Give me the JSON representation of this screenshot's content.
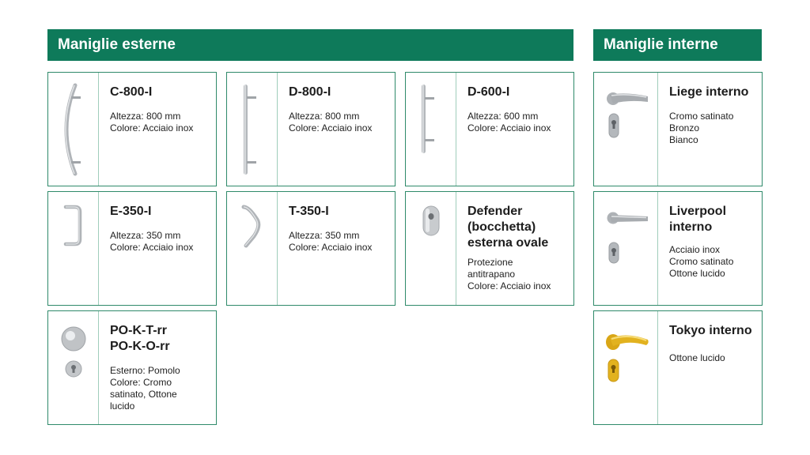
{
  "sections": {
    "external_title": "Maniglie esterne",
    "internal_title": "Maniglie interne"
  },
  "external": [
    {
      "title": "C-800-I",
      "lines": [
        "Altezza: 800 mm",
        "Colore: Acciaio inox"
      ],
      "icon": "curved-pull-handle-icon"
    },
    {
      "title": "D-800-I",
      "lines": [
        "Altezza: 800 mm",
        "Colore: Acciaio inox"
      ],
      "icon": "straight-pull-handle-icon"
    },
    {
      "title": "D-600-I",
      "lines": [
        "Altezza: 600 mm",
        "Colore: Acciaio inox"
      ],
      "icon": "straight-pull-handle-short-icon"
    },
    {
      "title": "E-350-I",
      "lines": [
        "Altezza: 350 mm",
        "Colore: Acciaio inox"
      ],
      "icon": "u-pull-handle-icon"
    },
    {
      "title": "T-350-I",
      "lines": [
        "Altezza: 350 mm",
        "Colore: Acciaio inox"
      ],
      "icon": "angled-pull-handle-icon"
    },
    {
      "title": "Defender (bocchetta) esterna ovale",
      "title_lines": [
        "Defender",
        "(bocchetta)",
        "esterna ovale"
      ],
      "lines": [
        "Protezione",
        "antitrapano",
        "Colore: Acciaio inox"
      ],
      "icon": "oval-escutcheon-icon"
    },
    {
      "title": "PO-K-T-rr PO-K-O-rr",
      "title_lines": [
        "PO-K-T-rr",
        "PO-K-O-rr"
      ],
      "lines": [
        "Esterno: Pomolo",
        "Colore: Cromo",
        "satinato, Ottone",
        "lucido"
      ],
      "icon": "knob-with-keyhole-icon"
    }
  ],
  "internal": [
    {
      "title": "Liege interno",
      "title_lines": [
        "Liege interno"
      ],
      "lines": [
        "Cromo satinato",
        "Bronzo",
        "Bianco"
      ],
      "icon": "lever-handle-icon"
    },
    {
      "title": "Liverpool interno",
      "title_lines": [
        "Liverpool",
        "interno"
      ],
      "lines": [
        "Acciaio inox",
        "Cromo satinato",
        "Ottone lucido"
      ],
      "icon": "lever-handle-icon"
    },
    {
      "title": "Tokyo interno",
      "title_lines": [
        "Tokyo interno"
      ],
      "lines": [
        "Ottone lucido"
      ],
      "icon": "gold-lever-handle-icon"
    }
  ],
  "colors": {
    "accent": "#0e7a5a",
    "border": "#2f8a6a",
    "steel": "#b8bcc0",
    "brass": "#e2b21f"
  }
}
